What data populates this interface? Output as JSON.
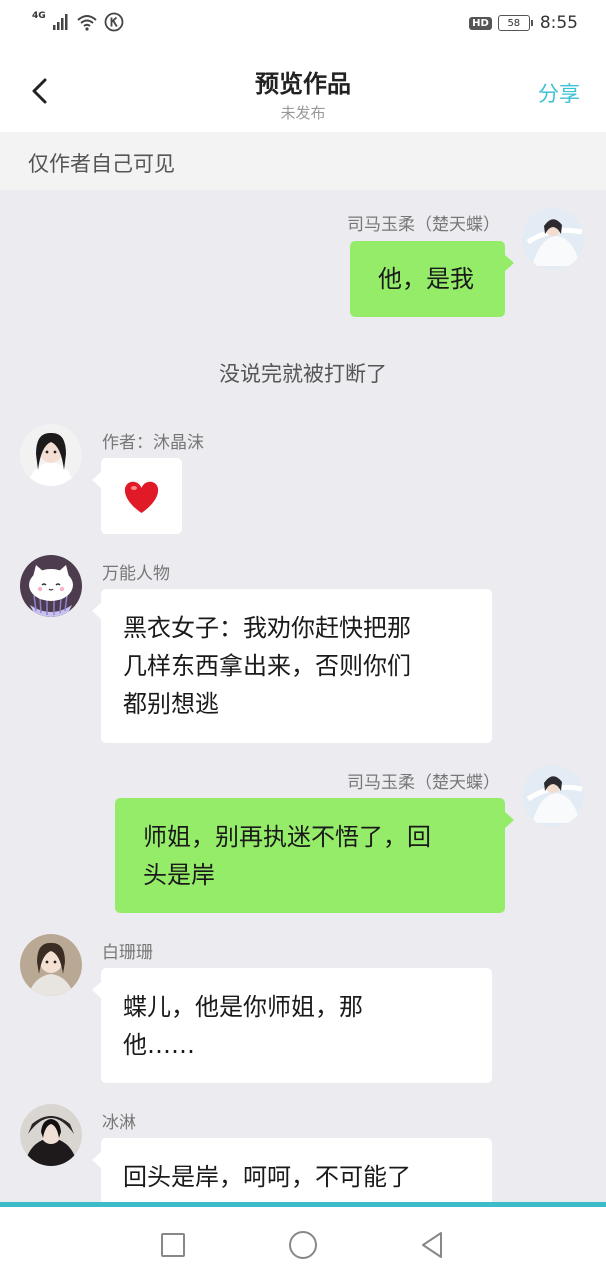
{
  "status_bar": {
    "network": "4G",
    "hd": "HD",
    "battery": "58",
    "time": "8:55"
  },
  "header": {
    "back_icon": "chevron-left-icon",
    "title": "预览作品",
    "subtitle": "未发布",
    "share_label": "分享"
  },
  "notice": "仅作者自己可见",
  "chat": {
    "msg1": {
      "name": "司马玉柔（楚天蝶）",
      "text": "他，是我"
    },
    "narration": "没说完就被打断了",
    "msg2": {
      "name": "作者：沐晶沫",
      "emoji": "❤️"
    },
    "msg3": {
      "name": "万能人物",
      "line1": "黑衣女子：我劝你赶快把那",
      "line2": "几样东西拿出来，否则你们",
      "line3": "都别想逃"
    },
    "msg4": {
      "name": "司马玉柔（楚天蝶）",
      "line1": "师姐，别再执迷不悟了，回",
      "line2": "头是岸"
    },
    "msg5": {
      "name": "白珊珊",
      "line1": "蝶儿，他是你师姐，那",
      "line2": "他……"
    },
    "msg6": {
      "name": "冰淋",
      "line1": "回头是岸，呵呵，不可能了"
    }
  },
  "colors": {
    "accent": "#3ec2d2",
    "bubble_right": "#95ec69",
    "bubble_left": "#ffffff",
    "chat_bg": "#ececf0"
  }
}
